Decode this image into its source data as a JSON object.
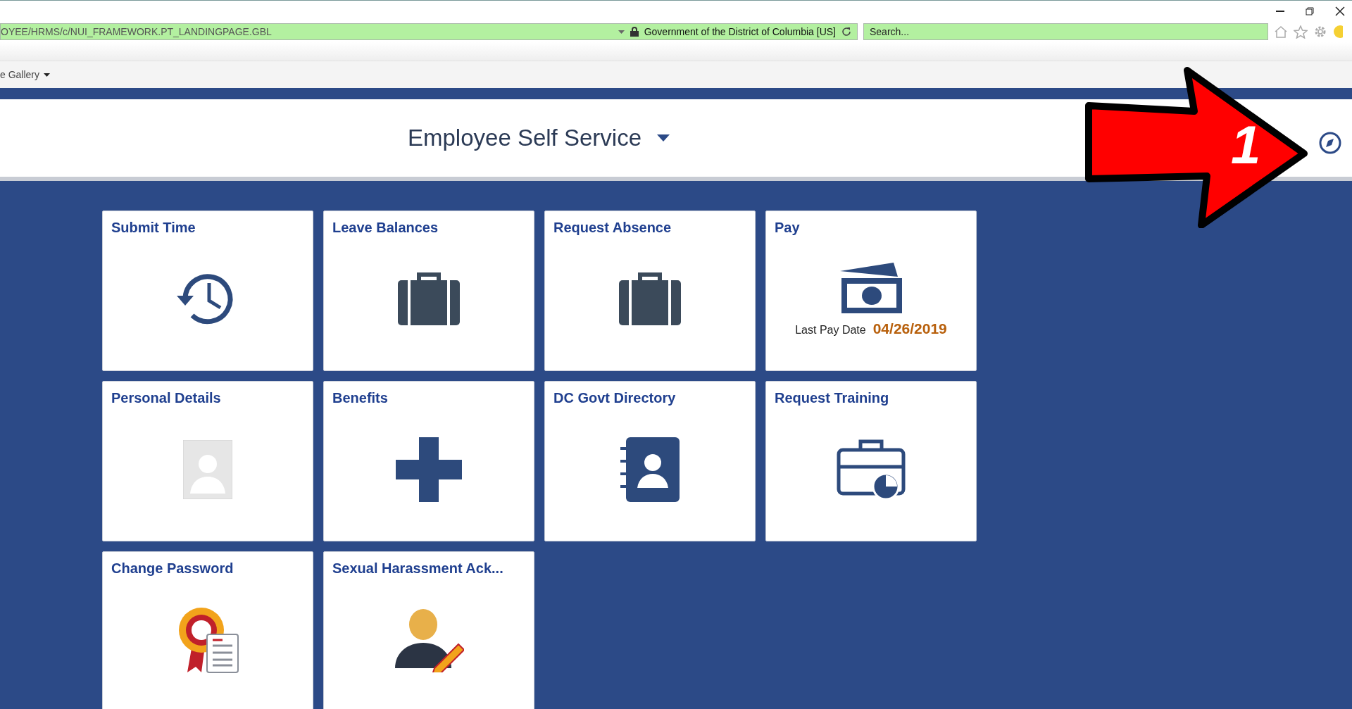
{
  "browser": {
    "address": "OYEE/HRMS/c/NUI_FRAMEWORK.PT_LANDINGPAGE.GBL",
    "site_identity": "Government of the District of Columbia [US]",
    "search": {
      "placeholder": "Search..."
    },
    "favorites": [
      {
        "label": "e Gallery"
      }
    ]
  },
  "header": {
    "title": "Employee Self Service"
  },
  "tiles": [
    {
      "title": "Submit Time"
    },
    {
      "title": "Leave Balances"
    },
    {
      "title": "Request Absence"
    },
    {
      "title": "Pay",
      "detail": {
        "label": "Last Pay Date",
        "value": "04/26/2019"
      }
    },
    {
      "title": "Personal Details"
    },
    {
      "title": "Benefits"
    },
    {
      "title": "DC Govt Directory"
    },
    {
      "title": "Request Training"
    },
    {
      "title": "Change Password"
    },
    {
      "title": "Sexual Harassment Ack..."
    }
  ],
  "annotation": {
    "label": "1"
  }
}
